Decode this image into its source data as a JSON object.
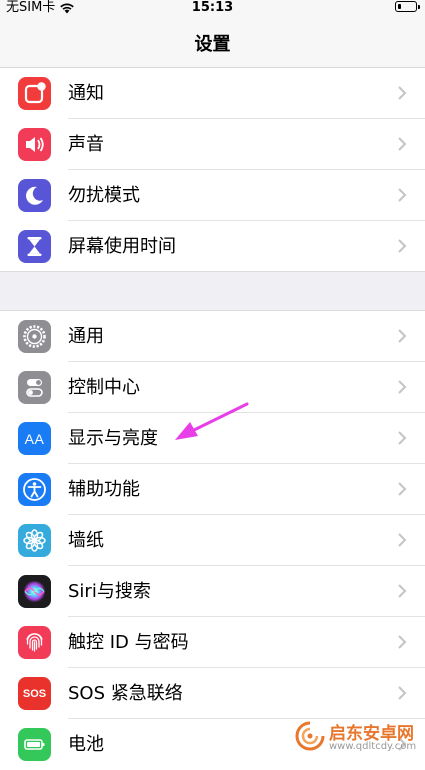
{
  "status_bar": {
    "carrier": "无SIM卡",
    "time": "15:13",
    "battery_level": 0.2
  },
  "nav": {
    "title": "设置"
  },
  "groups": [
    {
      "items": [
        {
          "label": "通知",
          "icon": "notifications-icon",
          "color": "#f23b3b"
        },
        {
          "label": "声音",
          "icon": "sounds-icon",
          "color": "#f23b57"
        },
        {
          "label": "勿扰模式",
          "icon": "do-not-disturb-icon",
          "color": "#5856d6"
        },
        {
          "label": "屏幕使用时间",
          "icon": "hourglass-icon",
          "color": "#5856d6"
        }
      ]
    },
    {
      "items": [
        {
          "label": "通用",
          "icon": "gear-icon",
          "color": "#8e8e93"
        },
        {
          "label": "控制中心",
          "icon": "control-center-icon",
          "color": "#8e8e93"
        },
        {
          "label": "显示与亮度",
          "icon": "display-brightness-icon",
          "color": "#1a7cf4"
        },
        {
          "label": "辅助功能",
          "icon": "accessibility-icon",
          "color": "#1a7cf4"
        },
        {
          "label": "墙纸",
          "icon": "wallpaper-icon",
          "color": "#35aadc"
        },
        {
          "label": "Siri与搜索",
          "icon": "siri-icon",
          "color": "#1c1c1e"
        },
        {
          "label": "触控 ID 与密码",
          "icon": "fingerprint-icon",
          "color": "#f23b57"
        },
        {
          "label": "SOS 紧急联络",
          "icon": "sos-icon",
          "color": "#e8322b"
        },
        {
          "label": "电池",
          "icon": "battery-icon",
          "color": "#34c759"
        }
      ]
    }
  ],
  "sos_icon_text": "SOS",
  "display_icon_text": "AA",
  "annotation": {
    "color": "#e83ee8"
  },
  "watermark": {
    "title": "启东安卓网",
    "url": "www.qdltcdy.com"
  }
}
